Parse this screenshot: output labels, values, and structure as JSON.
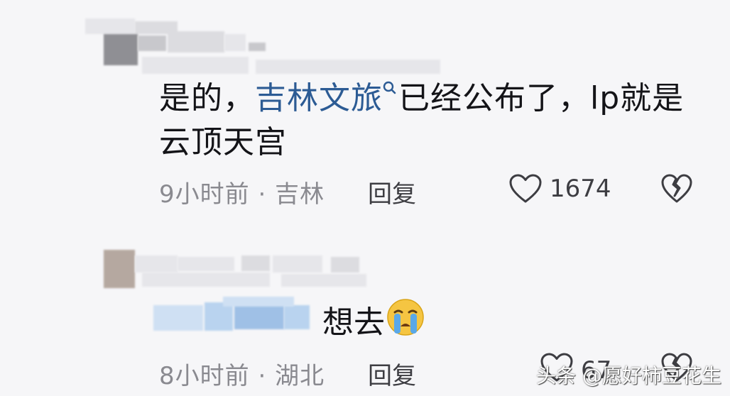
{
  "comment1": {
    "text_prefix": "是的，",
    "link_text": "吉林文旅",
    "text_suffix": "已经公布了，lp就是云顶天宫",
    "time": "9小时前",
    "location": "吉林",
    "reply_label": "回复",
    "like_count": "1674"
  },
  "comment2": {
    "text": "想去",
    "emoji": "crying-face",
    "time": "8小时前",
    "location": "湖北",
    "reply_label": "回复",
    "like_count": "67"
  },
  "watermark": "头条 @愿好柿豆花生",
  "colors": {
    "background": "#f6f6f8",
    "link": "#2c5b94",
    "meta": "#8a8a90"
  }
}
